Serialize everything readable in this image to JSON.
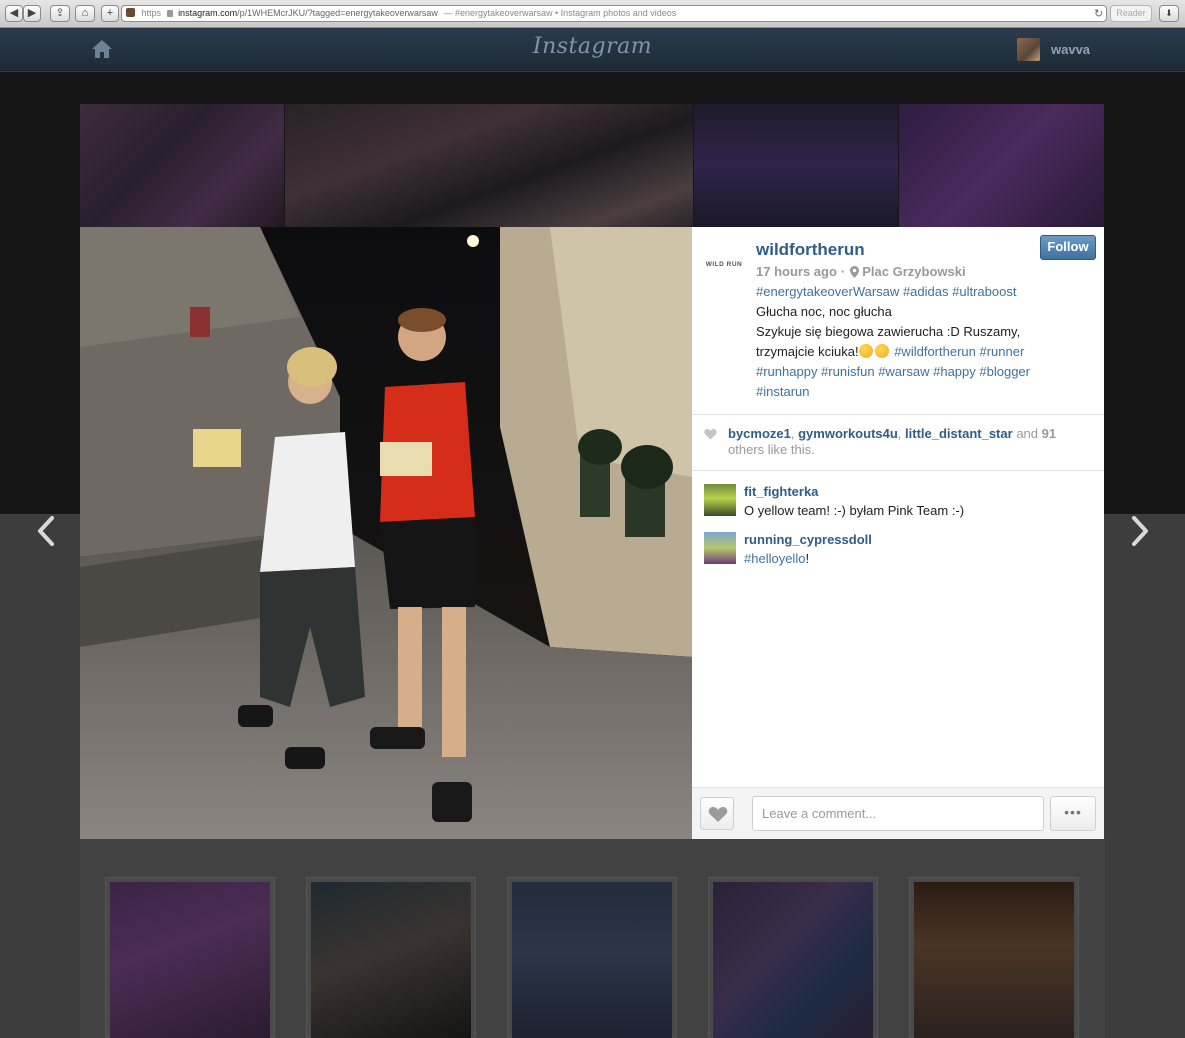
{
  "browser": {
    "url_scheme": "https",
    "url_host": "instagram.com",
    "url_path": "/p/1WHEMcrJKU/?tagged=energytakeoverwarsaw",
    "page_title": "— #energytakeoverwarsaw • Instagram photos and videos",
    "reader_label": "Reader"
  },
  "nav": {
    "logo_text": "Instagram",
    "username": "wavva"
  },
  "post": {
    "username": "wildfortherun",
    "avatar_text": "WILD RUN",
    "follow_label": "Follow",
    "time_ago": "17 hours ago",
    "separator": "·",
    "location": "Plac Grzybowski",
    "caption": {
      "tags_line1": [
        "#energytakeoverWarsaw",
        "#adidas",
        "#ultraboost"
      ],
      "line2": "Głucha noc, noc głucha",
      "line3": "Szykuje się biegowa zawierucha :D Ruszamy,",
      "line4_text": "trzymajcie kciuka!",
      "tags_line4": [
        "#wildfortherun",
        "#runner"
      ],
      "tags_line5": [
        "#runhappy",
        "#runisfun",
        "#warsaw",
        "#happy",
        "#blogger"
      ],
      "tags_line6": [
        "#instarun"
      ]
    }
  },
  "likes": {
    "users": [
      "bycmoze1",
      "gymworkouts4u",
      "little_distant_star"
    ],
    "and_label": "and",
    "count": "91",
    "suffix": "others like this."
  },
  "comments": [
    {
      "user": "fit_fighterka",
      "text": "O yellow team! :-) byłam Pink Team :-)"
    },
    {
      "user": "running_cypressdoll",
      "tag": "#helloyello",
      "text_after": "!"
    }
  ],
  "comment_box": {
    "placeholder": "Leave a comment...",
    "more_label": "•••"
  },
  "colors": {
    "link": "#2e5e86",
    "hashtag": "#3f729b",
    "follow_button": "#3f71a0",
    "nav_bar": "#243444"
  }
}
